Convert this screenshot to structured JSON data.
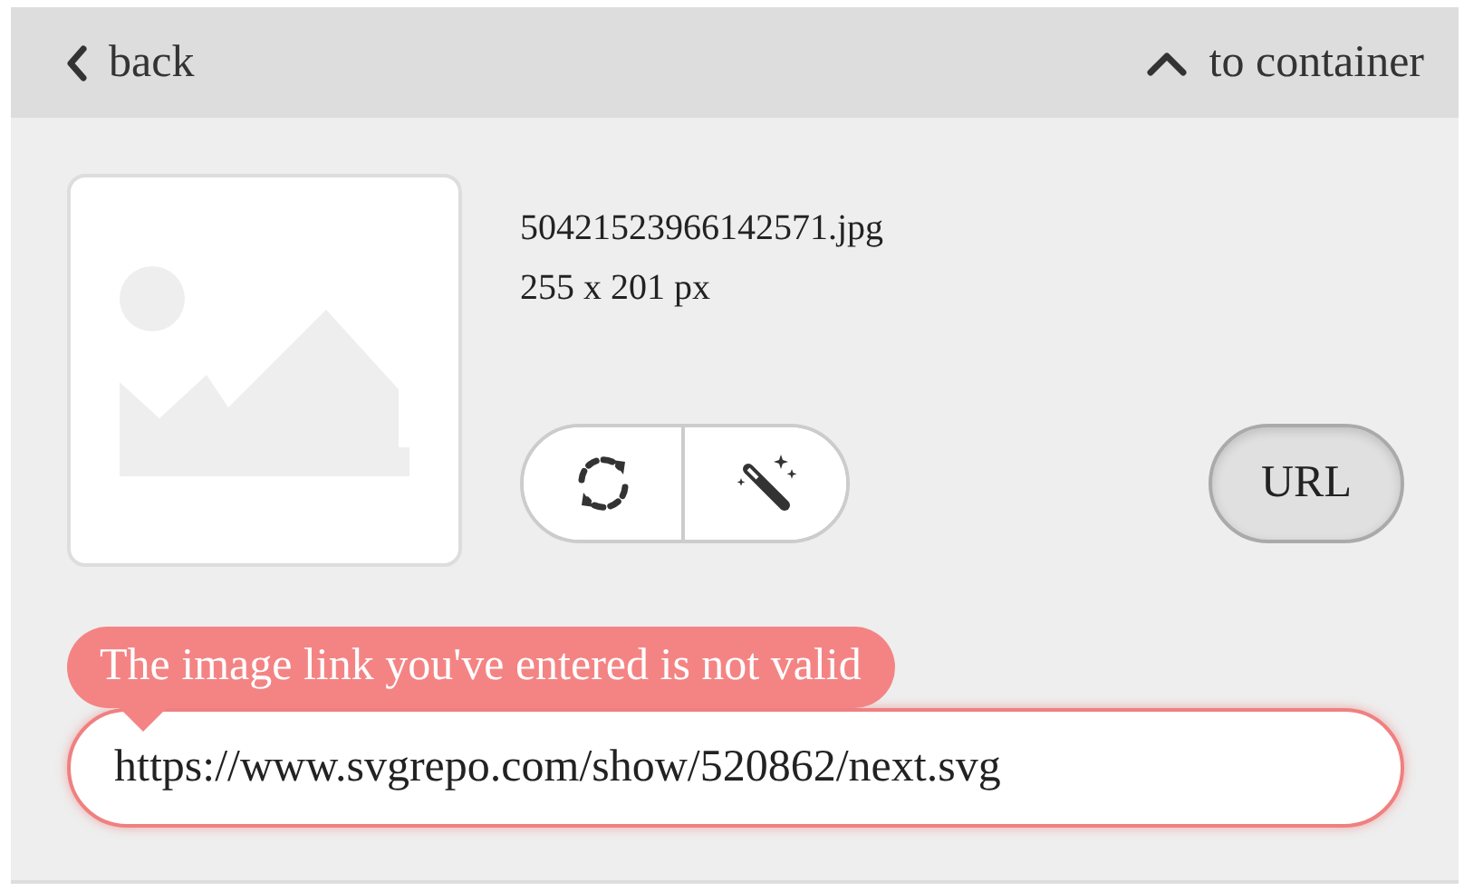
{
  "nav": {
    "back": "back",
    "up": "to container"
  },
  "image": {
    "kind": "picture",
    "filename": "50421523966142571.jpg",
    "dimensions": "255 x 201 px"
  },
  "url_button": {
    "label": "URL",
    "selected": true
  },
  "url_field": {
    "value": "https://www.svgrepo.com/show/520862/next.svg",
    "invalid": true,
    "error": "The image link you've entered is not valid"
  }
}
